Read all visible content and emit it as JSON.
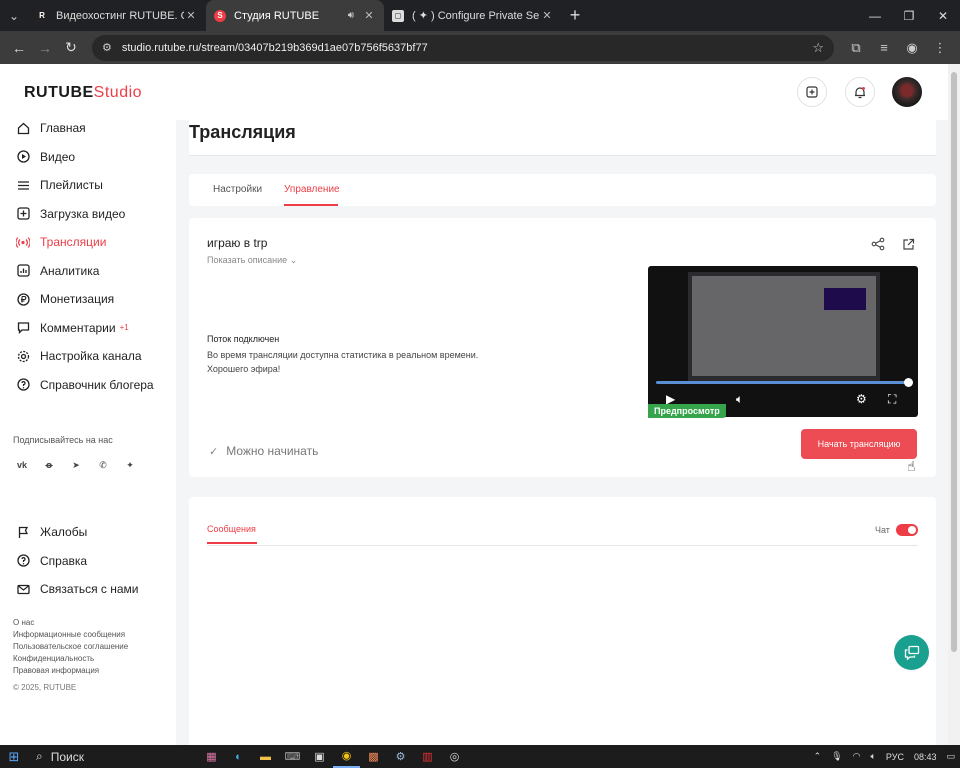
{
  "browser": {
    "tabs": [
      {
        "title": "Видеохостинг RUTUBE. Смотр",
        "favicon": "R",
        "active": false
      },
      {
        "title": "Студия RUTUBE",
        "favicon": "S",
        "active": true
      },
      {
        "title": "( ✦ ) Configure Private Server",
        "favicon": "◻",
        "active": false
      }
    ],
    "url": "studio.rutube.ru/stream/03407b219b369d1ae07b756f5637bf77"
  },
  "logo": {
    "brand": "RUTUBE",
    "studio": "Studio"
  },
  "sidebar": {
    "items": [
      {
        "label": "Главная",
        "icon": "home-icon",
        "active": false
      },
      {
        "label": "Видео",
        "icon": "video-icon",
        "active": false
      },
      {
        "label": "Плейлисты",
        "icon": "playlist-icon",
        "active": false
      },
      {
        "label": "Загрузка видео",
        "icon": "upload-icon",
        "active": false
      },
      {
        "label": "Трансляции",
        "icon": "broadcast-icon",
        "active": true
      },
      {
        "label": "Аналитика",
        "icon": "analytics-icon",
        "active": false
      },
      {
        "label": "Монетизация",
        "icon": "monetization-icon",
        "active": false
      },
      {
        "label": "Комментарии",
        "icon": "comments-icon",
        "active": false,
        "badge": "+1"
      },
      {
        "label": "Настройка канала",
        "icon": "settings-icon",
        "active": false
      },
      {
        "label": "Справочник блогера",
        "icon": "guide-icon",
        "active": false
      }
    ],
    "subscribe_title": "Подписывайтесь на нас",
    "socials": [
      "vk-icon",
      "ok-icon",
      "telegram-icon",
      "viber-icon",
      "dzen-icon"
    ],
    "secondary_items": [
      {
        "label": "Жалобы",
        "icon": "flag-icon"
      },
      {
        "label": "Справка",
        "icon": "help-icon"
      },
      {
        "label": "Связаться с нами",
        "icon": "mail-icon"
      }
    ],
    "footer_links": [
      "О нас",
      "Информационные сообщения",
      "Пользовательское соглашение",
      "Конфиденциальность",
      "Правовая информация"
    ],
    "copyright": "© 2025, RUTUBE"
  },
  "page": {
    "title": "Трансляция",
    "tabs": [
      {
        "label": "Настройки",
        "active": false
      },
      {
        "label": "Управление",
        "active": true
      }
    ]
  },
  "stream": {
    "title": "играю в trp",
    "show_description": "Показать описание",
    "status_heading": "Поток подключен",
    "status_text": "Во время трансляции доступна статистика в реальном времени. Хорошего эфира!",
    "preview_label": "Предпросмотр",
    "ready_text": "Можно начинать",
    "start_button": "Начать трансляцию"
  },
  "chat": {
    "tab_label": "Сообщения",
    "toggle_label": "Чат",
    "toggle_on": true
  },
  "taskbar": {
    "search": "Поиск",
    "lang": "РУС",
    "time": "08:43"
  },
  "colors": {
    "accent": "#ed3e47",
    "preview_green": "#35a44b",
    "help_fab": "#1aa08f"
  }
}
